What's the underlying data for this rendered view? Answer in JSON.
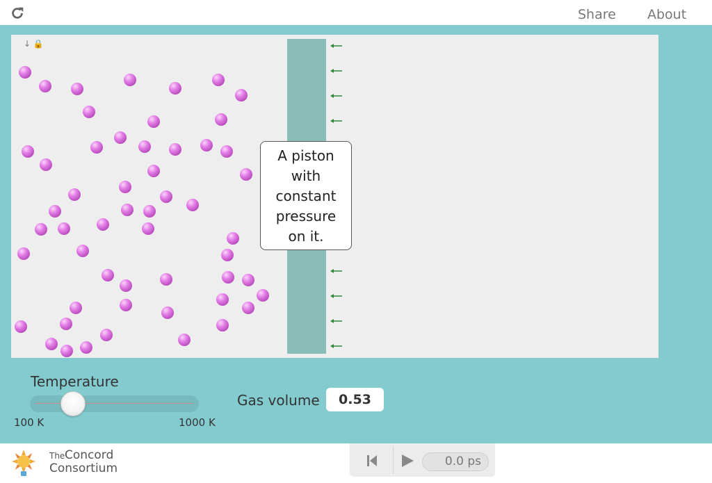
{
  "header": {
    "share_label": "Share",
    "about_label": "About",
    "reload_icon": "reload-icon"
  },
  "simulation": {
    "callout": [
      "A piston",
      "with",
      "constant",
      "pressure",
      "on it."
    ],
    "corner_icons": [
      "arrow-down-icon",
      "lock-icon"
    ],
    "piston_color": "#8cbcb6",
    "molecule_color": "#d972dc",
    "arrow_color": "#2e8b3a",
    "molecule_count": 63
  },
  "controls": {
    "temperature_label": "Temperature",
    "temperature_min_label": "100 K",
    "temperature_max_label": "1000 K",
    "temperature_value": 0.26,
    "gas_volume_label": "Gas volume",
    "gas_volume_value": "0.53"
  },
  "footer": {
    "logo_line1_small": "The",
    "logo_line1": "Concord",
    "logo_line2": "Consortium",
    "time_display": "0.0 ps"
  },
  "colors": {
    "background": "#84cbd0",
    "sim_bg": "#eeeeee"
  }
}
